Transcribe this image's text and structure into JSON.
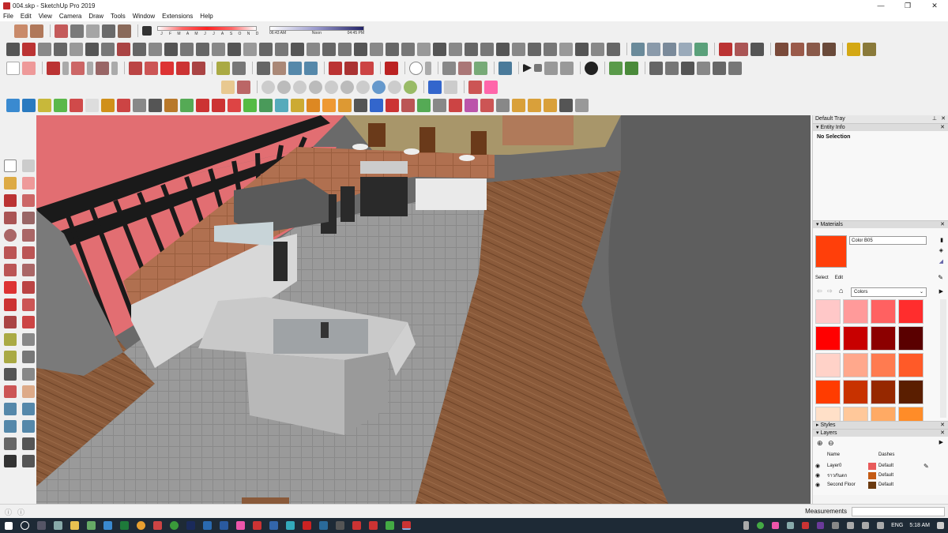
{
  "window": {
    "title": "004.skp - SketchUp Pro 2019",
    "minimize": "—",
    "maximize": "❐",
    "close": "✕"
  },
  "menu": [
    "File",
    "Edit",
    "View",
    "Camera",
    "Draw",
    "Tools",
    "Window",
    "Extensions",
    "Help"
  ],
  "shadows": {
    "months": [
      "J",
      "F",
      "M",
      "A",
      "M",
      "J",
      "J",
      "A",
      "S",
      "O",
      "N",
      "D"
    ],
    "time_start": "06:43 AM",
    "time_mid": "Noon",
    "time_end": "04:45 PM"
  },
  "tray": {
    "title": "Default Tray",
    "pin": "⊥",
    "close": "✕",
    "entity_info": {
      "label": "Entity Info",
      "status": "No Selection"
    },
    "materials": {
      "label": "Materials",
      "current_name": "Color B05",
      "current_color": "#ff3f0a",
      "tabs": [
        "Select",
        "Edit"
      ],
      "library": "Colors",
      "swatches": [
        "#ffc8c8",
        "#ff9a9a",
        "#ff6161",
        "#ff2d2d",
        "#ff0000",
        "#c80000",
        "#8c0000",
        "#5a0000",
        "#ffd2c8",
        "#ffa88c",
        "#ff7b50",
        "#ff5a28",
        "#ff3c00",
        "#c83200",
        "#962800",
        "#5a1e00",
        "#ffe0c8",
        "#ffc89a",
        "#ffaa64",
        "#ff8c28"
      ]
    },
    "styles": {
      "label": "Styles"
    },
    "layers": {
      "label": "Layers",
      "col_name": "Name",
      "col_dashes": "Dashes",
      "rows": [
        {
          "name": "Layer0",
          "color": "#e85a5a",
          "dashes": "Default"
        },
        {
          "name": "ราวกันตก",
          "color": "#c45a14",
          "dashes": "Default"
        },
        {
          "name": "Second Floor",
          "color": "#6b3a10",
          "dashes": "Default"
        }
      ]
    }
  },
  "status": {
    "measurements_label": "Measurements"
  },
  "taskbar": {
    "language": "ENG",
    "time": "5:18 AM"
  }
}
